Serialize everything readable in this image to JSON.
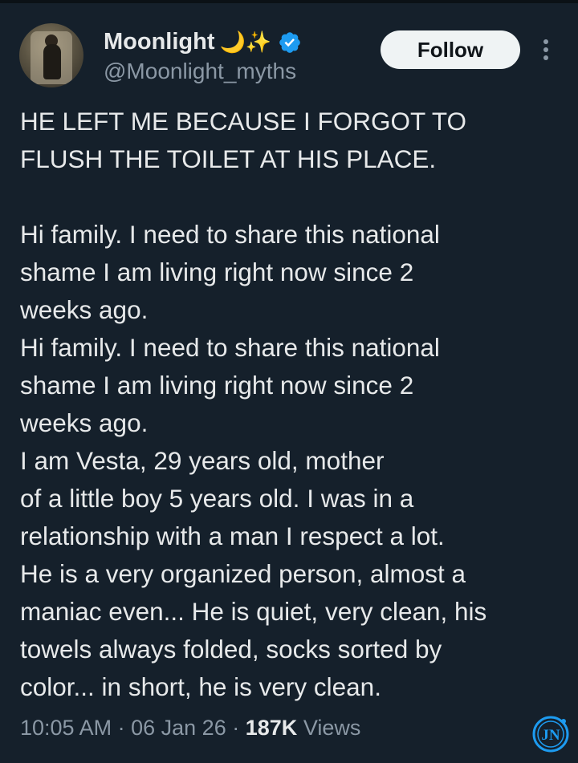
{
  "user": {
    "display_name": "Moonlight",
    "name_emojis": "🌙✨",
    "handle": "@Moonlight_myths",
    "verified": true,
    "verified_color": "#1d9bf0"
  },
  "follow_button": {
    "label": "Follow"
  },
  "more_menu": {
    "icon": "more-vertical-icon"
  },
  "tweet": {
    "lines": [
      "HE LEFT ME BECAUSE I FORGOT TO",
      "FLUSH THE TOILET AT HIS PLACE.",
      "",
      "Hi family. I need to share this national",
      "shame I am living right now since 2",
      "weeks ago.",
      "Hi family. I need to share this national",
      "shame I am living right now since 2",
      "weeks ago.",
      "I am Vesta, 29 years old, mother",
      "of a little boy 5 years old. I was in a",
      "relationship with a man I respect a lot.",
      "He is a very organized person, almost a",
      "maniac even... He is quiet, very clean, his",
      "towels always folded, socks sorted by",
      "color... in short, he is very clean."
    ]
  },
  "meta": {
    "time": "10:05 AM",
    "separator": "·",
    "date": "06 Jan 26",
    "views_count": "187K",
    "views_label": "Views"
  },
  "watermark": {
    "text": "JN",
    "color": "#1d9bf0"
  },
  "colors": {
    "background": "#15202b",
    "text_primary": "#e7e9ea",
    "text_secondary": "#8b98a5",
    "button_bg": "#eff3f4"
  }
}
